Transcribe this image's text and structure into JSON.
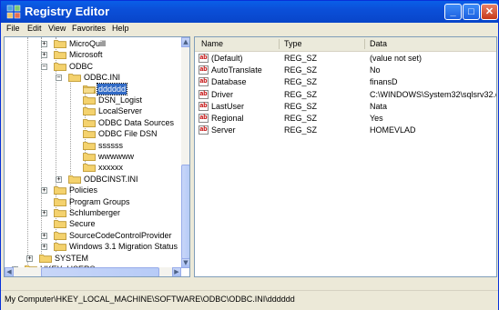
{
  "window": {
    "title": "Registry Editor"
  },
  "menu": [
    "File",
    "Edit",
    "View",
    "Favorites",
    "Help"
  ],
  "tree": {
    "items": [
      {
        "label": "MicroQuill",
        "expander": "+"
      },
      {
        "label": "Microsoft",
        "expander": "+"
      },
      {
        "label": "ODBC",
        "expander": "-"
      },
      {
        "label": "ODBC.INI",
        "expander": "-"
      },
      {
        "label": "dddddd",
        "expander": "",
        "selected": true
      },
      {
        "label": "DSN_Logist",
        "expander": ""
      },
      {
        "label": "LocalServer",
        "expander": ""
      },
      {
        "label": "ODBC Data Sources",
        "expander": ""
      },
      {
        "label": "ODBC File DSN",
        "expander": ""
      },
      {
        "label": "ssssss",
        "expander": ""
      },
      {
        "label": "wwwwww",
        "expander": ""
      },
      {
        "label": "xxxxxx",
        "expander": ""
      },
      {
        "label": "ODBCINST.INI",
        "expander": "+"
      },
      {
        "label": "Policies",
        "expander": "+"
      },
      {
        "label": "Program Groups",
        "expander": ""
      },
      {
        "label": "Schlumberger",
        "expander": "+"
      },
      {
        "label": "Secure",
        "expander": ""
      },
      {
        "label": "SourceCodeControlProvider",
        "expander": "+"
      },
      {
        "label": "Windows 3.1 Migration Status",
        "expander": "+"
      },
      {
        "label": "SYSTEM",
        "expander": "+"
      },
      {
        "label": "HKEY_USERS",
        "expander": "+"
      }
    ]
  },
  "list": {
    "columns": [
      "Name",
      "Type",
      "Data"
    ],
    "rows": [
      {
        "name": "(Default)",
        "type": "REG_SZ",
        "data": "(value not set)"
      },
      {
        "name": "AutoTranslate",
        "type": "REG_SZ",
        "data": "No"
      },
      {
        "name": "Database",
        "type": "REG_SZ",
        "data": "finansD"
      },
      {
        "name": "Driver",
        "type": "REG_SZ",
        "data": "C:\\WINDOWS\\System32\\sqlsrv32.dll"
      },
      {
        "name": "LastUser",
        "type": "REG_SZ",
        "data": "Nata"
      },
      {
        "name": "Regional",
        "type": "REG_SZ",
        "data": "Yes"
      },
      {
        "name": "Server",
        "type": "REG_SZ",
        "data": "HOMEVLAD"
      }
    ],
    "value_icon": "ab"
  },
  "status": {
    "path": "My Computer\\HKEY_LOCAL_MACHINE\\SOFTWARE\\ODBC\\ODBC.INI\\dddddd"
  },
  "colors": {
    "titlebar": "#0b4fd8",
    "selection": "#316ac5",
    "folder": "#f4d26e"
  }
}
